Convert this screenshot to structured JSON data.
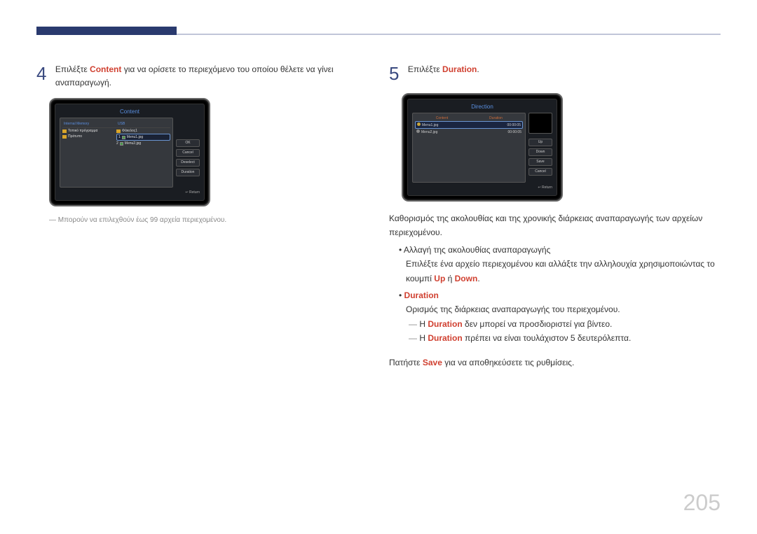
{
  "page_number": "205",
  "left": {
    "step_num": "4",
    "step_text_1": "Επιλέξτε ",
    "step_hl_1": "Content",
    "step_text_2": " για να ορίσετε το περιεχόμενο του οποίου θέλετε να γίνει αναπαραγωγή.",
    "note": "Μπορούν να επιλεχθούν έως 99 αρχεία περιεχομένου.",
    "ss": {
      "title": "Content",
      "tab_left": "Internal Memory",
      "tab_right": "USB",
      "left_items": [
        "Τοπικό πρόγραμμα",
        "Πρότυπο"
      ],
      "right_items": [
        {
          "idx": "",
          "name": "Φάκελος1"
        },
        {
          "idx": "1",
          "name": "Menu1.jpg"
        },
        {
          "idx": "2",
          "name": "Menu2.jpg"
        }
      ],
      "buttons": [
        "OK",
        "Cancel",
        "Deselect",
        "Duration"
      ],
      "footer": "↩ Return"
    }
  },
  "right": {
    "step_num": "5",
    "step_text_1": "Επιλέξτε ",
    "step_hl_1": "Duration",
    "step_text_2": ".",
    "ss": {
      "title": "Direction",
      "tab_left": "Content",
      "tab_right": "Duration",
      "rows": [
        {
          "name": "Menu1.jpg",
          "dur": "00:00:05"
        },
        {
          "name": "Menu2.jpg",
          "dur": "00:00:05"
        }
      ],
      "buttons": [
        "Up",
        "Down",
        "Save",
        "Cancel"
      ],
      "footer": "↩ Return"
    },
    "desc1": "Καθορισμός της ακολουθίας και της χρονικής διάρκειας αναπαραγωγής των αρχείων περιεχομένου.",
    "b1_title": "Αλλαγή της ακολουθίας αναπαραγωγής",
    "b1_sub_1": "Επιλέξτε ένα αρχείο περιεχομένου και αλλάξτε την αλληλουχία χρησιμοποιώντας το κουμπί ",
    "b1_hl_up": "Up",
    "b1_or": " ή ",
    "b1_hl_down": "Down",
    "b1_dot": ".",
    "b2_hl": "Duration",
    "b2_sub": "Ορισμός της διάρκειας αναπαραγωγής του περιεχομένου.",
    "dash1_1": "Η ",
    "dash1_hl": "Duration",
    "dash1_2": " δεν μπορεί να προσδιοριστεί για βίντεο.",
    "dash2_1": "Η ",
    "dash2_hl": "Duration",
    "dash2_2": " πρέπει να είναι τουλάχιστον 5 δευτερόλεπτα.",
    "final_1": "Πατήστε ",
    "final_hl": "Save",
    "final_2": " για να αποθηκεύσετε τις ρυθμίσεις."
  }
}
